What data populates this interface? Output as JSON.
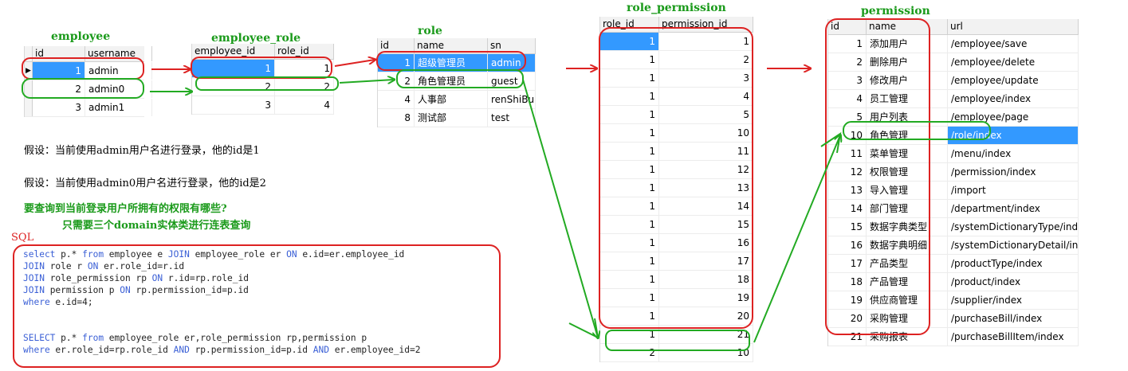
{
  "employee": {
    "title": "employee",
    "columns": [
      "id",
      "username"
    ],
    "rows": [
      [
        "1",
        "admin"
      ],
      [
        "2",
        "admin0"
      ],
      [
        "3",
        "admin1"
      ]
    ]
  },
  "employee_role": {
    "title": "employee_role",
    "columns": [
      "employee_id",
      "role_id"
    ],
    "rows": [
      [
        "1",
        "1"
      ],
      [
        "2",
        "2"
      ],
      [
        "3",
        "4"
      ]
    ]
  },
  "role": {
    "title": "role",
    "columns": [
      "id",
      "name",
      "sn"
    ],
    "rows": [
      [
        "1",
        "超级管理员",
        "admin"
      ],
      [
        "2",
        "角色管理员",
        "guest"
      ],
      [
        "4",
        "人事部",
        "renShiBu"
      ],
      [
        "8",
        "测试部",
        "test"
      ]
    ]
  },
  "role_permission": {
    "title": "role_permission",
    "columns": [
      "role_id",
      "permission_id"
    ],
    "rows": [
      [
        "1",
        "1"
      ],
      [
        "1",
        "2"
      ],
      [
        "1",
        "3"
      ],
      [
        "1",
        "4"
      ],
      [
        "1",
        "5"
      ],
      [
        "1",
        "10"
      ],
      [
        "1",
        "11"
      ],
      [
        "1",
        "12"
      ],
      [
        "1",
        "13"
      ],
      [
        "1",
        "14"
      ],
      [
        "1",
        "15"
      ],
      [
        "1",
        "16"
      ],
      [
        "1",
        "17"
      ],
      [
        "1",
        "18"
      ],
      [
        "1",
        "19"
      ],
      [
        "1",
        "20"
      ],
      [
        "1",
        "21"
      ],
      [
        "2",
        "10"
      ]
    ]
  },
  "permission": {
    "title": "permission",
    "columns": [
      "id",
      "name",
      "url"
    ],
    "rows": [
      [
        "1",
        "添加用户",
        "/employee/save"
      ],
      [
        "2",
        "删除用户",
        "/employee/delete"
      ],
      [
        "3",
        "修改用户",
        "/employee/update"
      ],
      [
        "4",
        "员工管理",
        "/employee/index"
      ],
      [
        "5",
        "用户列表",
        "/employee/page"
      ],
      [
        "10",
        "角色管理",
        "/role/index"
      ],
      [
        "11",
        "菜单管理",
        "/menu/index"
      ],
      [
        "12",
        "权限管理",
        "/permission/index"
      ],
      [
        "13",
        "导入管理",
        "/import"
      ],
      [
        "14",
        "部门管理",
        "/department/index"
      ],
      [
        "15",
        "数据字典类型",
        "/systemDictionaryType/index"
      ],
      [
        "16",
        "数据字典明细",
        "/systemDictionaryDetail/index"
      ],
      [
        "17",
        "产品类型",
        "/productType/index"
      ],
      [
        "18",
        "产品管理",
        "/product/index"
      ],
      [
        "19",
        "供应商管理",
        "/supplier/index"
      ],
      [
        "20",
        "采购管理",
        "/purchaseBill/index"
      ],
      [
        "21",
        "采购报表",
        "/purchaseBillItem/index"
      ]
    ]
  },
  "notes": {
    "assume1": "假设：当前使用admin用户名进行登录，他的id是1",
    "assume2": "假设：当前使用admin0用户名进行登录，他的id是2",
    "question": "要查询到当前登录用户所拥有的权限有哪些?",
    "answer": "只需要三个domain实体类进行连表查询"
  },
  "sql": {
    "label": "SQL",
    "q1_l1": [
      "select",
      " p.* ",
      "from",
      " employee e ",
      "JOIN",
      " employee_role er ",
      "ON",
      " e.id=er.employee_id"
    ],
    "q1_l2": [
      "JOIN",
      " role r ",
      "ON",
      " er.role_id=r.id"
    ],
    "q1_l3": [
      "JOIN",
      " role_permission rp ",
      "ON",
      " r.id=rp.role_id"
    ],
    "q1_l4": [
      "JOIN",
      " permission p ",
      "ON",
      " rp.permission_id=p.id"
    ],
    "q1_l5": [
      "where",
      " e.id=4;"
    ],
    "q2_l1": [
      "SELECT",
      " p.* ",
      "from",
      " employee_role er,role_permission rp,permission p"
    ],
    "q2_l2": [
      "where",
      " er.role_id=rp.role_id ",
      "AND",
      " rp.permission_id=p.id ",
      "AND",
      " er.employee_id=2"
    ]
  },
  "colors": {
    "red": "#dd2222",
    "green": "#22aa22",
    "title_green": "#1a9a1a",
    "selection": "#3399ff",
    "keyword": "#3a5fd6"
  }
}
